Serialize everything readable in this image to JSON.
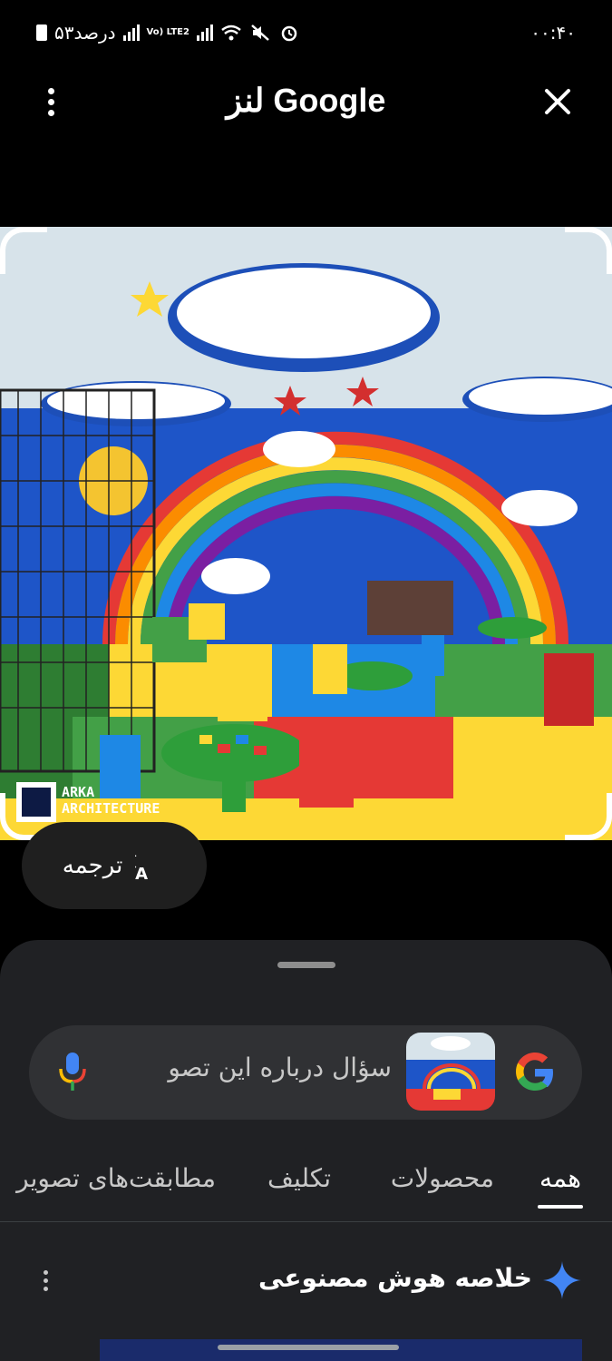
{
  "status_bar": {
    "time": "۰۰:۴۰",
    "battery_text": "۵۳درصد",
    "network_label": "Vo) LTE2"
  },
  "header": {
    "title": "لنز Google"
  },
  "image_watermark": {
    "line1": "ARKA",
    "line2": "ARCHITECTURE"
  },
  "translate_chip": {
    "label": "ترجمه"
  },
  "search": {
    "placeholder": "سؤال درباره این تصو"
  },
  "tabs": [
    {
      "label": "همه",
      "active": true
    },
    {
      "label": "محصولات",
      "active": false
    },
    {
      "label": "تکلیف",
      "active": false
    },
    {
      "label": "مطابقت‌های تصویر",
      "active": false
    }
  ],
  "ai_overview": {
    "title": "خلاصه هوش مصنوعی"
  },
  "colors": {
    "background": "#000000",
    "sheet": "#202124",
    "search_bg": "#303134",
    "accent_blue": "#4285f4"
  }
}
